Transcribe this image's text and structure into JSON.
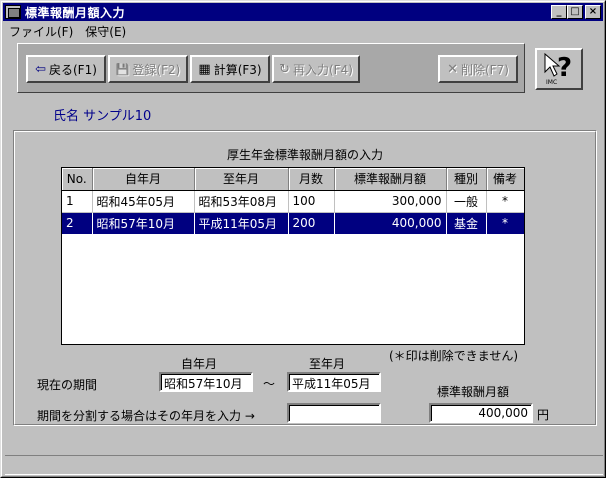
{
  "window": {
    "title": "標準報酬月額入力",
    "min_glyph": "_",
    "max_glyph": "□",
    "close_glyph": "×"
  },
  "menu": {
    "file": "ファイル(F)",
    "save": "保守(E)"
  },
  "toolbar": {
    "back": {
      "label": "戻る(F1)",
      "icon": "arrow-left-icon",
      "glyph": "⇦"
    },
    "register": {
      "label": "登録(F2)",
      "icon": "floppy-disk-icon",
      "glyph": "💾"
    },
    "calculate": {
      "label": "計算(F3)",
      "icon": "calculator-icon",
      "glyph": "▦"
    },
    "reenter": {
      "label": "再入力(F4)",
      "icon": "refresh-icon",
      "glyph": "↻"
    },
    "delete": {
      "label": "削除(F7)",
      "icon": "delete-x-icon",
      "glyph": "✕"
    },
    "help": {
      "icon": "help-imc-icon",
      "text": "IMC"
    }
  },
  "patient": {
    "name": "氏名 サンプル10"
  },
  "section": {
    "title": "厚生年金標準報酬月額の入力"
  },
  "table": {
    "headers": [
      "No.",
      "自年月",
      "至年月",
      "月数",
      "標準報酬月額",
      "種別",
      "備考"
    ],
    "rows": [
      {
        "no": "1",
        "from": "昭和45年05月",
        "to": "昭和53年08月",
        "months": "100",
        "amount": "300,000",
        "type": "一般",
        "note": "*"
      },
      {
        "no": "2",
        "from": "昭和57年10月",
        "to": "平成11年05月",
        "months": "200",
        "amount": "400,000",
        "type": "基金",
        "note": "*"
      }
    ],
    "selected_row": 1
  },
  "note": "(＊印は削除できません)",
  "form": {
    "from_header": "自年月",
    "to_header": "至年月",
    "current_period_label": "現在の期間",
    "current_from": "昭和57年10月",
    "tilde": "〜",
    "current_to": "平成11年05月",
    "split_label": "期間を分割する場合はその年月を入力 →",
    "split_value": "",
    "amount_header": "標準報酬月額",
    "amount_value": "400,000",
    "amount_unit": "円"
  }
}
